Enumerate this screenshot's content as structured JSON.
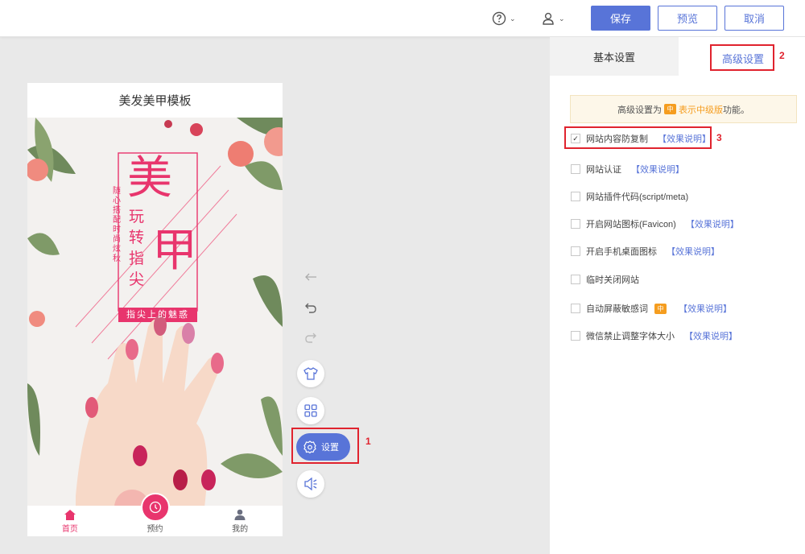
{
  "topbar": {
    "help_icon": "question-circle-icon",
    "user_icon": "user-icon",
    "dropdown_glyph": "⌄",
    "save_label": "保存",
    "preview_label": "预览",
    "cancel_label": "取消"
  },
  "phone": {
    "title": "美发美甲模板",
    "banner": {
      "big_char_1": "美",
      "big_char_2": "甲",
      "line_1": "玩",
      "line_2": "转",
      "line_3": "指",
      "line_4": "尖",
      "vertical_text": "随心搭配时尚炫秋",
      "tagline": "指尖上的魅惑"
    },
    "tabs": [
      {
        "label": "首页",
        "icon": "home-icon",
        "active": true
      },
      {
        "label": "预约",
        "icon": "clock-icon",
        "active": false
      },
      {
        "label": "我的",
        "icon": "person-icon",
        "active": false
      }
    ]
  },
  "tools": {
    "settings_label": "设置",
    "annotation_1": "1"
  },
  "panel": {
    "tab_basic": "基本设置",
    "tab_advanced": "高级设置",
    "annotation_2": "2",
    "annotation_3": "3",
    "notice": {
      "prefix": "高级设置为",
      "badge": "中",
      "highlight": "表示中级版",
      "suffix": "功能。"
    },
    "options": [
      {
        "label": "网站内容防复制",
        "link": "【效果说明】",
        "checked": true,
        "badge": ""
      },
      {
        "label": "网站认证",
        "link": "【效果说明】",
        "checked": false,
        "badge": ""
      },
      {
        "label": "网站插件代码(script/meta)",
        "link": "",
        "checked": false,
        "badge": ""
      },
      {
        "label": "开启网站图标(Favicon)",
        "link": "【效果说明】",
        "checked": false,
        "badge": ""
      },
      {
        "label": "开启手机桌面图标",
        "link": "【效果说明】",
        "checked": false,
        "badge": ""
      },
      {
        "label": "临时关闭网站",
        "link": "",
        "checked": false,
        "badge": ""
      },
      {
        "label": "自动屏蔽敏感词",
        "link": "【效果说明】",
        "checked": false,
        "badge": "中"
      },
      {
        "label": "微信禁止调整字体大小",
        "link": "【效果说明】",
        "checked": false,
        "badge": ""
      }
    ],
    "check_glyph": "✓"
  },
  "colors": {
    "accent": "#5874d8",
    "pink": "#e8356d",
    "annotation_red": "#e0232e",
    "badge_orange": "#f59d1f"
  }
}
